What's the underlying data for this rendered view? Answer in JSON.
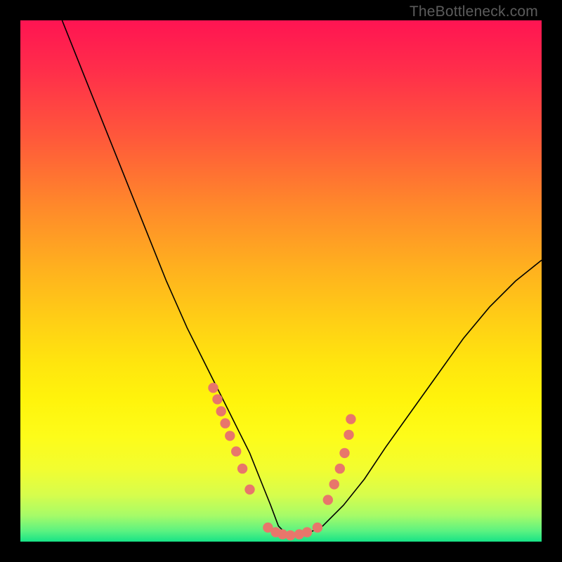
{
  "watermark": "TheBottleneck.com",
  "chart_data": {
    "type": "line",
    "title": "",
    "xlabel": "",
    "ylabel": "",
    "xlim": [
      0,
      100
    ],
    "ylim": [
      0,
      100
    ],
    "series": [
      {
        "name": "curve",
        "x": [
          8,
          12,
          16,
          20,
          24,
          28,
          32,
          36,
          40,
          42,
          44,
          46,
          48,
          49.5,
          51,
          53,
          55,
          58,
          62,
          66,
          70,
          75,
          80,
          85,
          90,
          95,
          100
        ],
        "y": [
          100,
          90,
          80,
          70,
          60,
          50,
          41,
          33,
          25,
          21,
          17,
          12,
          7,
          3,
          1.5,
          1.2,
          1.5,
          3,
          7,
          12,
          18,
          25,
          32,
          39,
          45,
          50,
          54
        ]
      }
    ],
    "markers": {
      "left_cluster": {
        "x": [
          37.0,
          37.8,
          38.5,
          39.3,
          40.2,
          41.4,
          42.6,
          44.0
        ],
        "y": [
          29.5,
          27.3,
          25.0,
          22.7,
          20.3,
          17.3,
          14.0,
          10.0
        ]
      },
      "trough": {
        "x": [
          47.5,
          49.0,
          50.3,
          51.8,
          53.5,
          55.0,
          57.0
        ],
        "y": [
          2.7,
          1.8,
          1.4,
          1.2,
          1.4,
          1.8,
          2.7
        ]
      },
      "right_cluster": {
        "x": [
          59.0,
          60.2,
          61.3,
          62.2,
          63.0,
          63.4
        ],
        "y": [
          8.0,
          11.0,
          14.0,
          17.0,
          20.5,
          23.5
        ]
      }
    },
    "marker_color": "#e8766b",
    "colors": {
      "gradient_top": "#ff1452",
      "gradient_bottom": "#17e386",
      "curve": "#000000",
      "frame": "#000000"
    }
  }
}
